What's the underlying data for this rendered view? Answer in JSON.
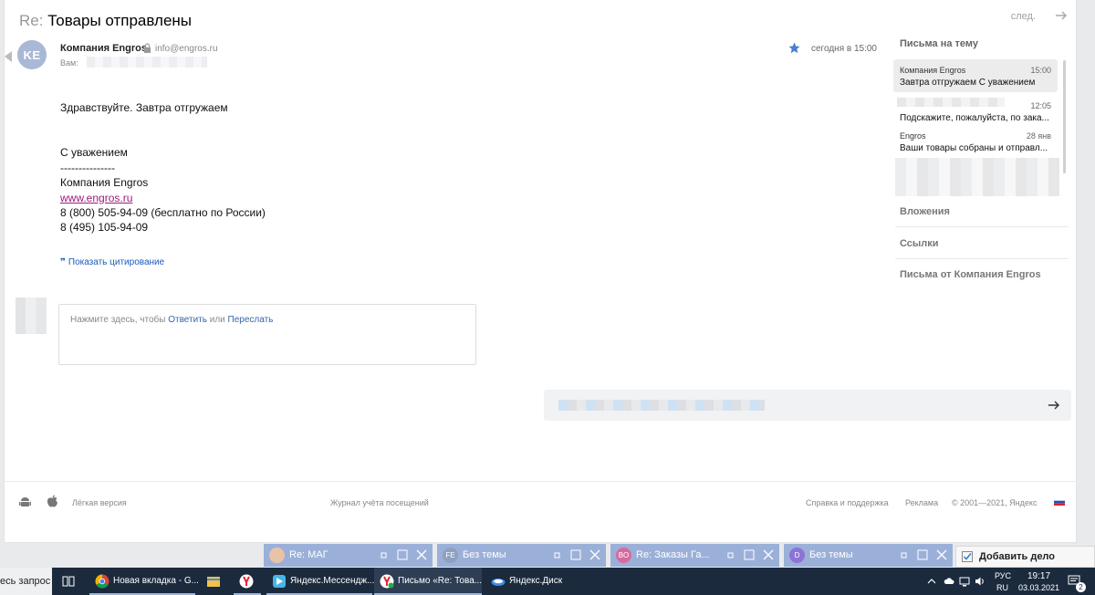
{
  "email": {
    "subject_prefix": "Re:",
    "subject": "Товары отправлены",
    "next_label": "след.",
    "avatar_initials": "KE",
    "from_name": "Компания Engros",
    "from_email": "info@engros.ru",
    "to_label": "Вам:",
    "date": "сегодня в 15:00",
    "body": {
      "greeting": "Здравствуйте. Завтра отгружаем",
      "sign_off": "С уважением",
      "separator": "---------------",
      "company": "Компания Engros",
      "website": "www.engros.ru",
      "phone1": "8 (800) 505-94-09 (бесплатно по России)",
      "phone2": "8 (495) 105-94-09"
    },
    "show_quote": "Показать цитирование",
    "reply": {
      "hint_prefix": "Нажмите здесь, чтобы",
      "reply_link": "Ответить",
      "or_word": "или",
      "forward_link": "Переслать"
    }
  },
  "sidebar": {
    "thread_title": "Письма на тему",
    "threads": [
      {
        "from": "Компания Engros",
        "time": "15:00",
        "snippet": "Завтра отгружаем С уважением"
      },
      {
        "from": "",
        "time": "12:05",
        "snippet": "Подскажите, пожалуйста, по зака..."
      },
      {
        "from": "Engros",
        "time": "28 янв",
        "snippet": "Ваши товары собраны и отправл..."
      }
    ],
    "sections": [
      "Вложения",
      "Ссылки",
      "Письма от Компания Engros"
    ]
  },
  "footer": {
    "light_version": "Лёгкая версия",
    "visit_log": "Журнал учёта посещений",
    "help": "Справка и поддержка",
    "ads": "Реклама",
    "copyright": "© 2001—2021, Яндекс"
  },
  "sticky_tabs": [
    {
      "badge": "",
      "title": "Re: МАГ",
      "badge_color": "#d98b67"
    },
    {
      "badge": "FE",
      "title": "Без темы",
      "badge_color": "#8fa0c0"
    },
    {
      "badge": "BO",
      "title": "Re: Заказы Га...",
      "badge_color": "#d66aa0"
    },
    {
      "badge": "D",
      "title": "Без темы",
      "badge_color": "#8d73d6"
    }
  ],
  "add_task": "Добавить дело",
  "taskbar": {
    "search_text": "есь запрос",
    "items": [
      {
        "label": "Новая вкладка - G...",
        "icon": "chrome-icon"
      },
      {
        "label": "",
        "icon": "file-explorer-icon"
      },
      {
        "label": "",
        "icon": "yandex-browser-icon"
      },
      {
        "label": "Яндекс.Мессендж...",
        "icon": "messenger-icon"
      },
      {
        "label": "Письмо «Re: Това...",
        "icon": "yandex-mail-icon"
      },
      {
        "label": "Яндекс.Диск",
        "icon": "yandex-disk-icon"
      }
    ],
    "lang_top": "РУС",
    "lang_bottom": "RU",
    "time": "19:17",
    "date": "03.03.2021",
    "notifications": "2"
  },
  "colors": {
    "accent_blue": "#4a7fd1",
    "link_purple": "#9a1c7a",
    "tab_blue": "#9bb0d8",
    "taskbar": "#1b2a3d"
  }
}
